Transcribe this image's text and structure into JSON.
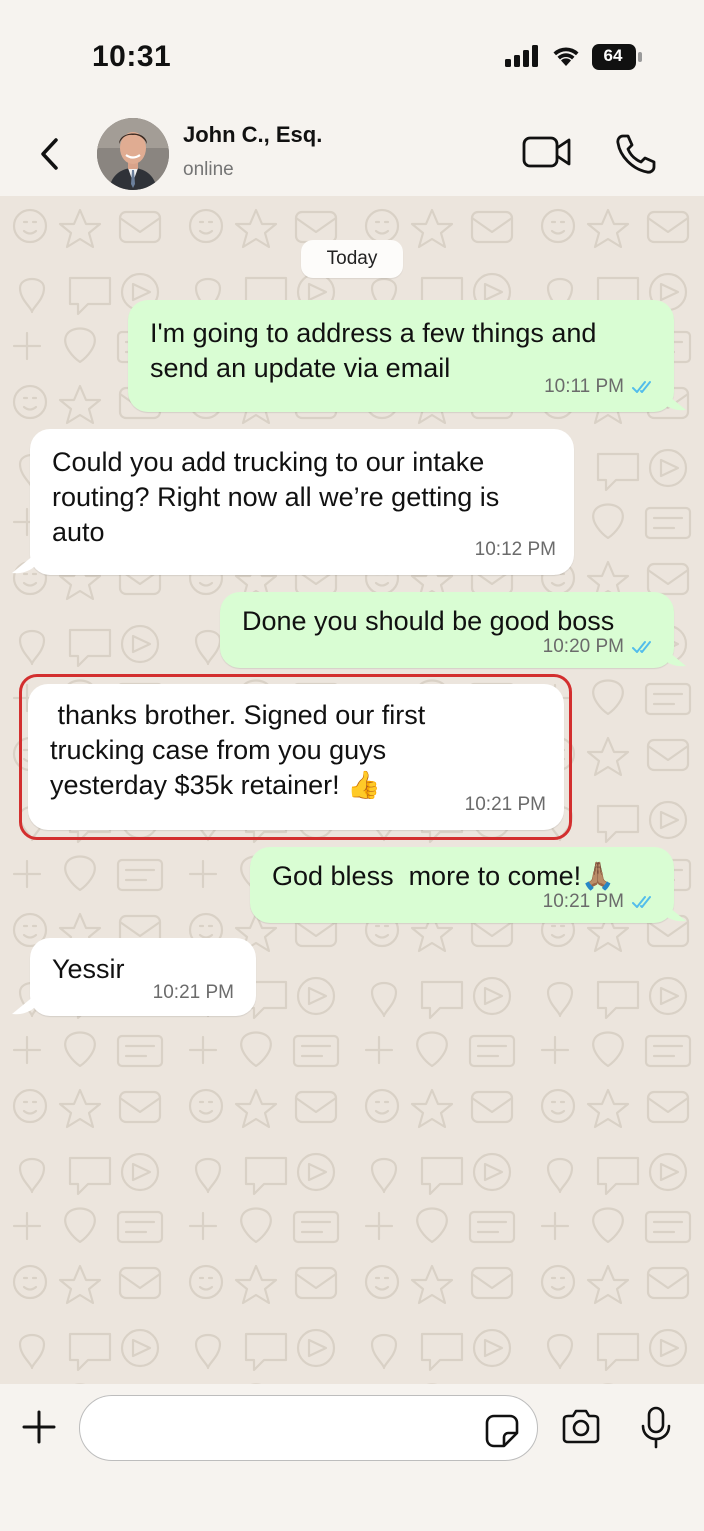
{
  "status_bar": {
    "time": "10:31",
    "battery": "64"
  },
  "header": {
    "contact_name": "John C., Esq.",
    "contact_status": "online"
  },
  "chat": {
    "date_label": "Today",
    "messages": [
      {
        "direction": "out",
        "text": "I'm going to address a few things and\nsend an update via email",
        "time": "10:11 PM",
        "read": true
      },
      {
        "direction": "in",
        "text": "Could you add trucking to our intake\nrouting? Right now all we’re getting is\nauto",
        "time": "10:12 PM"
      },
      {
        "direction": "out",
        "text": "Done you should be good boss",
        "time": "10:20 PM",
        "read": true
      },
      {
        "direction": "in",
        "text": " thanks brother. Signed our first\ntrucking case from you guys\nyesterday $35k retainer! 👍",
        "time": "10:21 PM",
        "highlighted": true
      },
      {
        "direction": "out",
        "text": "God bless  more to come!🙏🏽",
        "time": "10:21 PM",
        "read": true
      },
      {
        "direction": "in",
        "text": "Yessir",
        "time": "10:21 PM"
      }
    ],
    "highlight_color": "#d32f2f",
    "outgoing_bubble_color": "#d9fdd3",
    "incoming_bubble_color": "#ffffff",
    "read_tick_color": "#53bdeb"
  },
  "input_bar": {
    "icons": [
      "plus-icon",
      "sticker-icon",
      "camera-icon",
      "microphone-icon"
    ]
  }
}
